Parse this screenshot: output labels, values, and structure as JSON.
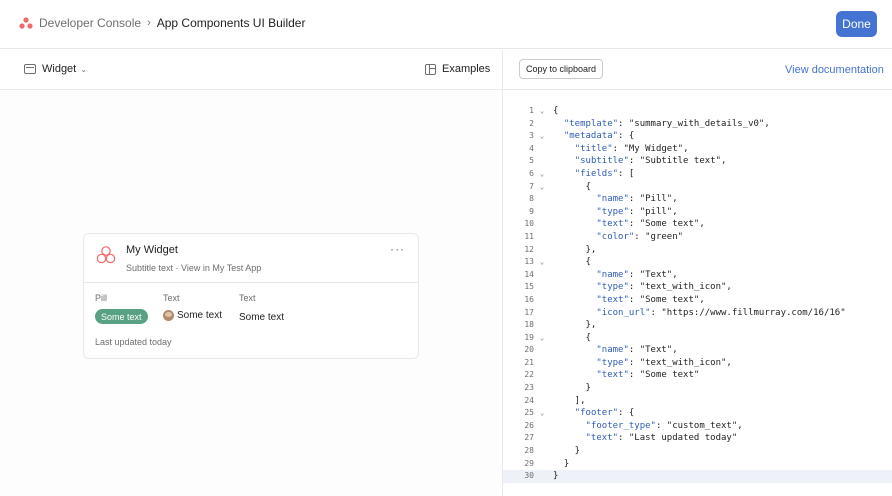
{
  "header": {
    "breadcrumb_root": "Developer Console",
    "breadcrumb_current": "App Components UI Builder",
    "done_label": "Done"
  },
  "left_toolbar": {
    "widget_select_label": "Widget",
    "examples_label": "Examples"
  },
  "right_toolbar": {
    "copy_label": "Copy to clipboard",
    "docs_label": "View documentation"
  },
  "widget_card": {
    "title": "My Widget",
    "subtitle": "Subtitle text · View in My Test App",
    "more": "···",
    "fields": [
      {
        "label": "Pill",
        "value": "Some text"
      },
      {
        "label": "Text",
        "value": "Some text"
      },
      {
        "label": "Text",
        "value": "Some text"
      }
    ],
    "footer": "Last updated today"
  },
  "colors": {
    "accent": "#4573d2",
    "pill_green": "#58a182",
    "logo_coral": "#f06a6a"
  },
  "code_lines": [
    {
      "n": "1",
      "fold": "⌄",
      "text": "{"
    },
    {
      "n": "2",
      "fold": "",
      "text": "  \"template\": \"summary_with_details_v0\","
    },
    {
      "n": "3",
      "fold": "⌄",
      "text": "  \"metadata\": {"
    },
    {
      "n": "4",
      "fold": "",
      "text": "    \"title\": \"My Widget\","
    },
    {
      "n": "5",
      "fold": "",
      "text": "    \"subtitle\": \"Subtitle text\","
    },
    {
      "n": "6",
      "fold": "⌄",
      "text": "    \"fields\": ["
    },
    {
      "n": "7",
      "fold": "⌄",
      "text": "      {"
    },
    {
      "n": "8",
      "fold": "",
      "text": "        \"name\": \"Pill\","
    },
    {
      "n": "9",
      "fold": "",
      "text": "        \"type\": \"pill\","
    },
    {
      "n": "10",
      "fold": "",
      "text": "        \"text\": \"Some text\","
    },
    {
      "n": "11",
      "fold": "",
      "text": "        \"color\": \"green\""
    },
    {
      "n": "12",
      "fold": "",
      "text": "      },"
    },
    {
      "n": "13",
      "fold": "⌄",
      "text": "      {"
    },
    {
      "n": "14",
      "fold": "",
      "text": "        \"name\": \"Text\","
    },
    {
      "n": "15",
      "fold": "",
      "text": "        \"type\": \"text_with_icon\","
    },
    {
      "n": "16",
      "fold": "",
      "text": "        \"text\": \"Some text\","
    },
    {
      "n": "17",
      "fold": "",
      "text": "        \"icon_url\": \"https://www.fillmurray.com/16/16\""
    },
    {
      "n": "18",
      "fold": "",
      "text": "      },"
    },
    {
      "n": "19",
      "fold": "⌄",
      "text": "      {"
    },
    {
      "n": "20",
      "fold": "",
      "text": "        \"name\": \"Text\","
    },
    {
      "n": "21",
      "fold": "",
      "text": "        \"type\": \"text_with_icon\","
    },
    {
      "n": "22",
      "fold": "",
      "text": "        \"text\": \"Some text\""
    },
    {
      "n": "23",
      "fold": "",
      "text": "      }"
    },
    {
      "n": "24",
      "fold": "",
      "text": "    ],"
    },
    {
      "n": "25",
      "fold": "⌄",
      "text": "    \"footer\": {"
    },
    {
      "n": "26",
      "fold": "",
      "text": "      \"footer_type\": \"custom_text\","
    },
    {
      "n": "27",
      "fold": "",
      "text": "      \"text\": \"Last updated today\""
    },
    {
      "n": "28",
      "fold": "",
      "text": "    }"
    },
    {
      "n": "29",
      "fold": "",
      "text": "  }"
    },
    {
      "n": "30",
      "fold": "",
      "text": "}"
    }
  ]
}
